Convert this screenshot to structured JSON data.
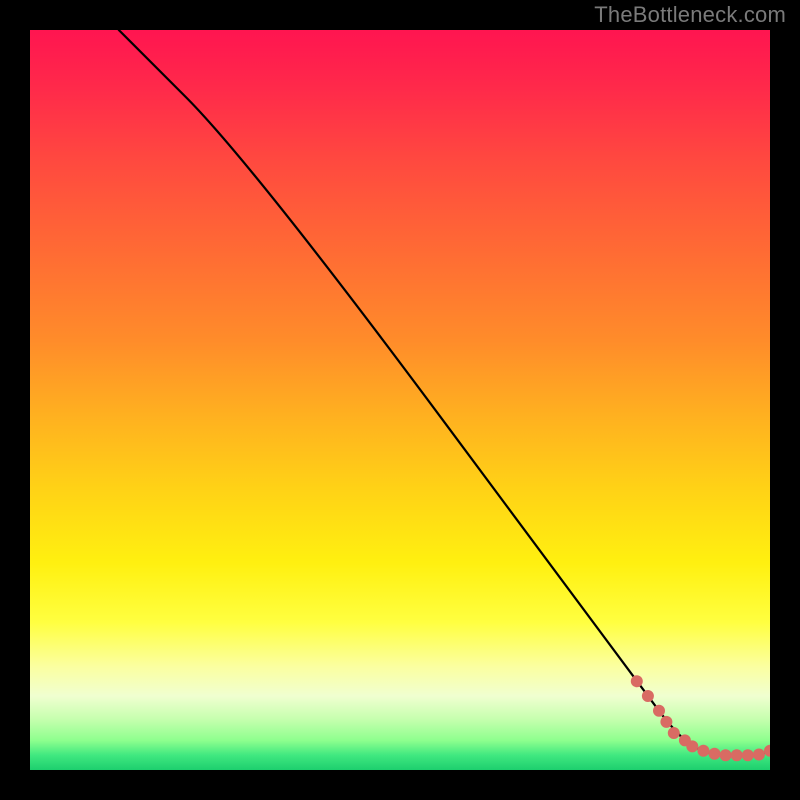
{
  "watermark": "TheBottleneck.com",
  "chart_data": {
    "type": "line",
    "title": "",
    "xlabel": "",
    "ylabel": "",
    "xlim": [
      0,
      100
    ],
    "ylim": [
      0,
      100
    ],
    "grid": false,
    "background": "red-yellow-green vertical gradient",
    "series": [
      {
        "name": "bottleneck-curve",
        "style": "line",
        "color": "#000000",
        "x": [
          12,
          30,
          82,
          88,
          92,
          95,
          98,
          100
        ],
        "y": [
          100,
          82,
          12,
          4,
          2,
          2,
          2,
          2.5
        ]
      },
      {
        "name": "scatter-points",
        "style": "scatter",
        "color": "#d96b63",
        "x": [
          82,
          83.5,
          85,
          86,
          87,
          88.5,
          89.5,
          91,
          92.5,
          94,
          95.5,
          97,
          98.5,
          100
        ],
        "y": [
          12,
          10,
          8,
          6.5,
          5,
          4,
          3.2,
          2.6,
          2.2,
          2.0,
          2.0,
          2.0,
          2.1,
          2.6
        ]
      }
    ]
  }
}
